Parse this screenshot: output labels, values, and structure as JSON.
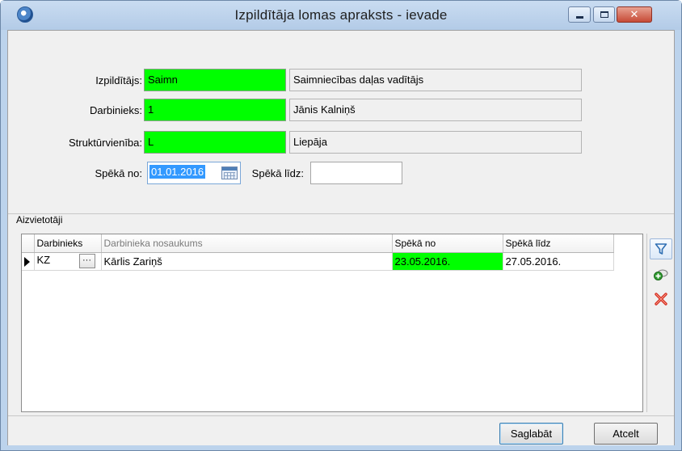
{
  "window": {
    "title": "Izpildītāja lomas apraksts - ievade",
    "controls": {
      "minimize": "minimize",
      "maximize": "maximize",
      "close": "✕"
    }
  },
  "form": {
    "executor": {
      "label": "Izpildītājs:",
      "code": "Saimn",
      "name": "Saimniecības daļas vadītājs"
    },
    "employee": {
      "label": "Darbinieks:",
      "code": "1",
      "name": "Jānis Kalniņš"
    },
    "unit": {
      "label": "Struktūrvienība:",
      "code": "L",
      "name": "Liepāja"
    },
    "valid_from": {
      "label": "Spēkā no:",
      "value": "01.01.2016"
    },
    "valid_to": {
      "label": "Spēkā līdz:",
      "value": ""
    }
  },
  "substitutes": {
    "group_title": "Aizvietotāji",
    "columns": [
      "Darbinieks",
      "Darbinieka nosaukums",
      "Spēkā no",
      "Spēkā līdz"
    ],
    "rows": [
      {
        "code": "KZ",
        "ellipsis": "···",
        "name": "Kārlis Zariņš",
        "from": "23.05.2016.",
        "to": "27.05.2016."
      }
    ]
  },
  "buttons": {
    "save": "Saglabāt",
    "cancel": "Atcelt"
  },
  "colors": {
    "required_field": "#00ff00",
    "selection": "#3399ff",
    "title_bar": "#c9dcf1"
  },
  "icons": [
    "app-globe-icon",
    "calendar-icon",
    "filter-icon",
    "add-record-icon",
    "delete-icon",
    "row-indicator-icon"
  ]
}
